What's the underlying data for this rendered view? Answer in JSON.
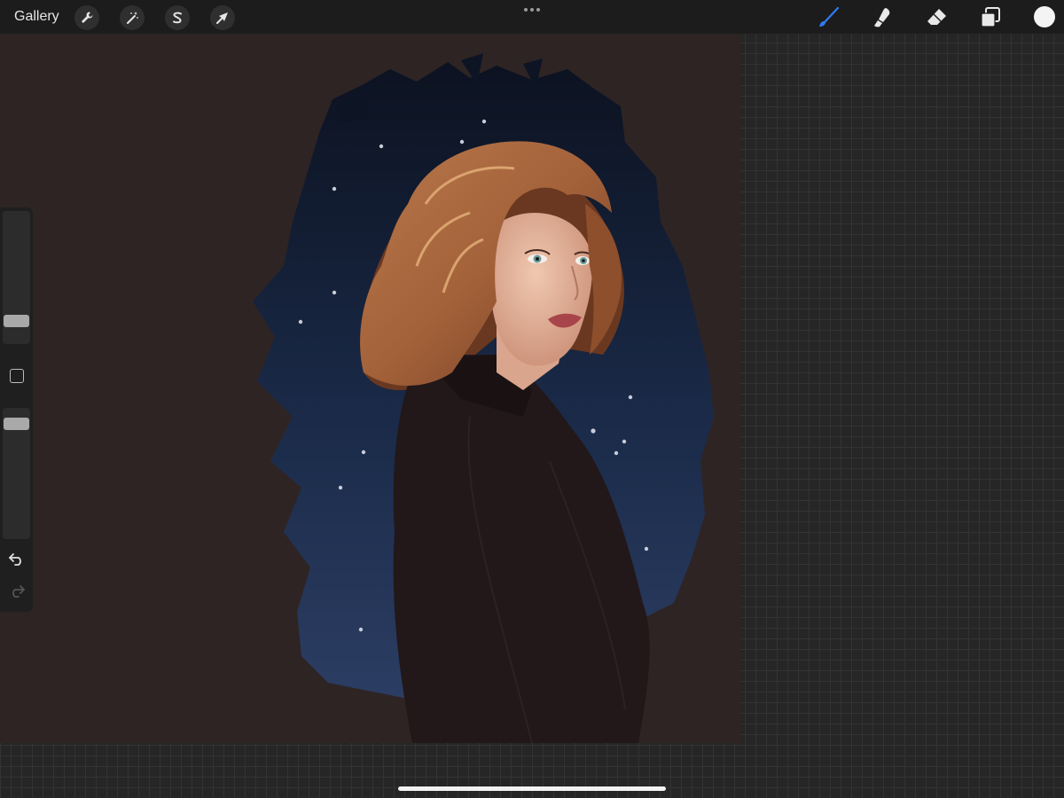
{
  "toolbar": {
    "gallery_label": "Gallery",
    "active_tool": "brush",
    "current_color": "#f4f4f4",
    "accent_color": "#2f7bf5"
  },
  "sidebar": {
    "brush_size": 0.14,
    "opacity": 0.92
  },
  "icons": [
    "wrench-icon",
    "magic-wand-icon",
    "selection-s-icon",
    "arrow-transform-icon",
    "more-dots-icon",
    "brush-icon",
    "smudge-icon",
    "eraser-icon",
    "layers-icon",
    "undo-icon",
    "redo-icon"
  ]
}
